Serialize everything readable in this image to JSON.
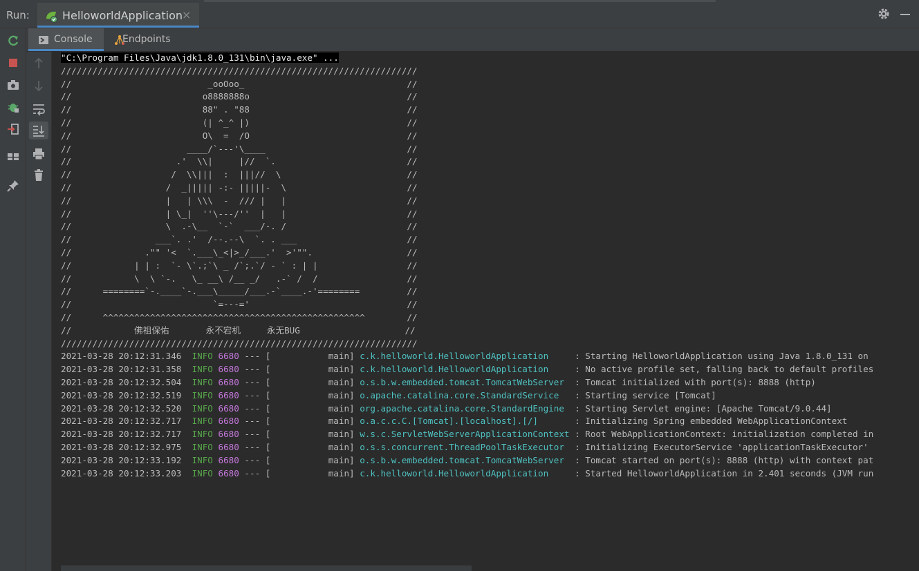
{
  "run_bar": {
    "label": "Run:",
    "tab_title": "HelloworldApplication",
    "close_symbol": "×"
  },
  "sub_tabs": [
    {
      "label": "Console",
      "icon": "console-icon",
      "active": true
    },
    {
      "label": "Endpoints",
      "icon": "endpoints-icon",
      "active": false
    }
  ],
  "console": {
    "command": "\"C:\\Program Files\\Java\\jdk1.8.0_131\\bin\\java.exe\" ...",
    "banner": "////////////////////////////////////////////////////////////////////\n//                          _ooOoo_                               //\n//                         o8888888o                              //\n//                         88\" . \"88                              //\n//                         (| ^_^ |)                              //\n//                         O\\  =  /O                              //\n//                      ____/`---'\\____                           //\n//                    .'  \\\\|     |//  `.                         //\n//                   /  \\\\|||  :  |||//  \\                        //\n//                  /  _||||| -:- |||||-  \\                       //\n//                  |   | \\\\\\  -  /// |   |                       //\n//                  | \\_|  ''\\---/''  |   |                       //\n//                  \\  .-\\__  `-`  ___/-. /                       //\n//                ___`. .'  /--.--\\  `. . ___                     //\n//              .\"\" '<  `.___\\_<|>_/___.'  >'\"\".                  //\n//            | | :  `- \\`.;`\\ _ /`;.`/ - ` : | |                 //\n//            \\  \\ `-.   \\_ __\\ /__ _/   .-` /  /                 //\n//      ========`-.____`-.___\\_____/___.-`____.-'========         //\n//                           `=---='                              //\n//      ^^^^^^^^^^^^^^^^^^^^^^^^^^^^^^^^^^^^^^^^^^^^^^^^^^        //\n//            佛祖保佑       永不宕机     永无BUG                    //\n////////////////////////////////////////////////////////////////////",
    "log_lines": [
      {
        "time": "2021-03-28 20:12:31.346",
        "level": "INFO",
        "pid": "6680",
        "sep": "--- [           main]",
        "logger": "c.k.helloworld.HelloworldApplication    ",
        "message": ": Starting HelloworldApplication using Java 1.8.0_131 on"
      },
      {
        "time": "2021-03-28 20:12:31.358",
        "level": "INFO",
        "pid": "6680",
        "sep": "--- [           main]",
        "logger": "c.k.helloworld.HelloworldApplication    ",
        "message": ": No active profile set, falling back to default profiles"
      },
      {
        "time": "2021-03-28 20:12:32.504",
        "level": "INFO",
        "pid": "6680",
        "sep": "--- [           main]",
        "logger": "o.s.b.w.embedded.tomcat.TomcatWebServer ",
        "message": ": Tomcat initialized with port(s): 8888 (http)"
      },
      {
        "time": "2021-03-28 20:12:32.519",
        "level": "INFO",
        "pid": "6680",
        "sep": "--- [           main]",
        "logger": "o.apache.catalina.core.StandardService  ",
        "message": ": Starting service [Tomcat]"
      },
      {
        "time": "2021-03-28 20:12:32.520",
        "level": "INFO",
        "pid": "6680",
        "sep": "--- [           main]",
        "logger": "org.apache.catalina.core.StandardEngine ",
        "message": ": Starting Servlet engine: [Apache Tomcat/9.0.44]"
      },
      {
        "time": "2021-03-28 20:12:32.717",
        "level": "INFO",
        "pid": "6680",
        "sep": "--- [           main]",
        "logger": "o.a.c.c.C.[Tomcat].[localhost].[/]      ",
        "message": ": Initializing Spring embedded WebApplicationContext"
      },
      {
        "time": "2021-03-28 20:12:32.717",
        "level": "INFO",
        "pid": "6680",
        "sep": "--- [           main]",
        "logger": "w.s.c.ServletWebServerApplicationContext",
        "message": ": Root WebApplicationContext: initialization completed in"
      },
      {
        "time": "2021-03-28 20:12:32.975",
        "level": "INFO",
        "pid": "6680",
        "sep": "--- [           main]",
        "logger": "o.s.s.concurrent.ThreadPoolTaskExecutor ",
        "message": ": Initializing ExecutorService 'applicationTaskExecutor'"
      },
      {
        "time": "2021-03-28 20:12:33.192",
        "level": "INFO",
        "pid": "6680",
        "sep": "--- [           main]",
        "logger": "o.s.b.w.embedded.tomcat.TomcatWebServer ",
        "message": ": Tomcat started on port(s): 8888 (http) with context pat"
      },
      {
        "time": "2021-03-28 20:12:33.203",
        "level": "INFO",
        "pid": "6680",
        "sep": "--- [           main]",
        "logger": "c.k.helloworld.HelloworldApplication    ",
        "message": ": Started HelloworldApplication in 2.401 seconds (JVM run"
      }
    ]
  },
  "colors": {
    "accent": "#4a88c7",
    "info": "#57a64a",
    "pid": "#c678dd",
    "logger": "#4fc1c1",
    "rerun": "#59a869",
    "stop": "#c75450"
  }
}
